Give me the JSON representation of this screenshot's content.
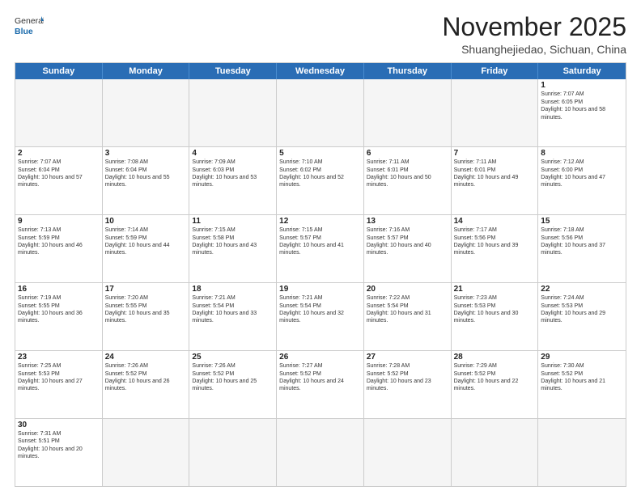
{
  "header": {
    "logo_general": "General",
    "logo_blue": "Blue",
    "month_year": "November 2025",
    "location": "Shuanghejiedao, Sichuan, China"
  },
  "weekdays": [
    "Sunday",
    "Monday",
    "Tuesday",
    "Wednesday",
    "Thursday",
    "Friday",
    "Saturday"
  ],
  "weeks": [
    [
      {
        "day": "",
        "empty": true
      },
      {
        "day": "",
        "empty": true
      },
      {
        "day": "",
        "empty": true
      },
      {
        "day": "",
        "empty": true
      },
      {
        "day": "",
        "empty": true
      },
      {
        "day": "",
        "empty": true
      },
      {
        "day": "1",
        "sunrise": "7:07 AM",
        "sunset": "6:05 PM",
        "daylight": "10 hours and 58 minutes."
      }
    ],
    [
      {
        "day": "2",
        "sunrise": "7:07 AM",
        "sunset": "6:04 PM",
        "daylight": "10 hours and 57 minutes."
      },
      {
        "day": "3",
        "sunrise": "7:08 AM",
        "sunset": "6:04 PM",
        "daylight": "10 hours and 55 minutes."
      },
      {
        "day": "4",
        "sunrise": "7:09 AM",
        "sunset": "6:03 PM",
        "daylight": "10 hours and 53 minutes."
      },
      {
        "day": "5",
        "sunrise": "7:10 AM",
        "sunset": "6:02 PM",
        "daylight": "10 hours and 52 minutes."
      },
      {
        "day": "6",
        "sunrise": "7:11 AM",
        "sunset": "6:01 PM",
        "daylight": "10 hours and 50 minutes."
      },
      {
        "day": "7",
        "sunrise": "7:11 AM",
        "sunset": "6:01 PM",
        "daylight": "10 hours and 49 minutes."
      },
      {
        "day": "8",
        "sunrise": "7:12 AM",
        "sunset": "6:00 PM",
        "daylight": "10 hours and 47 minutes."
      }
    ],
    [
      {
        "day": "9",
        "sunrise": "7:13 AM",
        "sunset": "5:59 PM",
        "daylight": "10 hours and 46 minutes."
      },
      {
        "day": "10",
        "sunrise": "7:14 AM",
        "sunset": "5:59 PM",
        "daylight": "10 hours and 44 minutes."
      },
      {
        "day": "11",
        "sunrise": "7:15 AM",
        "sunset": "5:58 PM",
        "daylight": "10 hours and 43 minutes."
      },
      {
        "day": "12",
        "sunrise": "7:15 AM",
        "sunset": "5:57 PM",
        "daylight": "10 hours and 41 minutes."
      },
      {
        "day": "13",
        "sunrise": "7:16 AM",
        "sunset": "5:57 PM",
        "daylight": "10 hours and 40 minutes."
      },
      {
        "day": "14",
        "sunrise": "7:17 AM",
        "sunset": "5:56 PM",
        "daylight": "10 hours and 39 minutes."
      },
      {
        "day": "15",
        "sunrise": "7:18 AM",
        "sunset": "5:56 PM",
        "daylight": "10 hours and 37 minutes."
      }
    ],
    [
      {
        "day": "16",
        "sunrise": "7:19 AM",
        "sunset": "5:55 PM",
        "daylight": "10 hours and 36 minutes."
      },
      {
        "day": "17",
        "sunrise": "7:20 AM",
        "sunset": "5:55 PM",
        "daylight": "10 hours and 35 minutes."
      },
      {
        "day": "18",
        "sunrise": "7:21 AM",
        "sunset": "5:54 PM",
        "daylight": "10 hours and 33 minutes."
      },
      {
        "day": "19",
        "sunrise": "7:21 AM",
        "sunset": "5:54 PM",
        "daylight": "10 hours and 32 minutes."
      },
      {
        "day": "20",
        "sunrise": "7:22 AM",
        "sunset": "5:54 PM",
        "daylight": "10 hours and 31 minutes."
      },
      {
        "day": "21",
        "sunrise": "7:23 AM",
        "sunset": "5:53 PM",
        "daylight": "10 hours and 30 minutes."
      },
      {
        "day": "22",
        "sunrise": "7:24 AM",
        "sunset": "5:53 PM",
        "daylight": "10 hours and 29 minutes."
      }
    ],
    [
      {
        "day": "23",
        "sunrise": "7:25 AM",
        "sunset": "5:53 PM",
        "daylight": "10 hours and 27 minutes."
      },
      {
        "day": "24",
        "sunrise": "7:26 AM",
        "sunset": "5:52 PM",
        "daylight": "10 hours and 26 minutes."
      },
      {
        "day": "25",
        "sunrise": "7:26 AM",
        "sunset": "5:52 PM",
        "daylight": "10 hours and 25 minutes."
      },
      {
        "day": "26",
        "sunrise": "7:27 AM",
        "sunset": "5:52 PM",
        "daylight": "10 hours and 24 minutes."
      },
      {
        "day": "27",
        "sunrise": "7:28 AM",
        "sunset": "5:52 PM",
        "daylight": "10 hours and 23 minutes."
      },
      {
        "day": "28",
        "sunrise": "7:29 AM",
        "sunset": "5:52 PM",
        "daylight": "10 hours and 22 minutes."
      },
      {
        "day": "29",
        "sunrise": "7:30 AM",
        "sunset": "5:52 PM",
        "daylight": "10 hours and 21 minutes."
      }
    ],
    [
      {
        "day": "30",
        "sunrise": "7:31 AM",
        "sunset": "5:51 PM",
        "daylight": "10 hours and 20 minutes."
      },
      {
        "day": "",
        "empty": true
      },
      {
        "day": "",
        "empty": true
      },
      {
        "day": "",
        "empty": true
      },
      {
        "day": "",
        "empty": true
      },
      {
        "day": "",
        "empty": true
      },
      {
        "day": "",
        "empty": true
      }
    ]
  ]
}
